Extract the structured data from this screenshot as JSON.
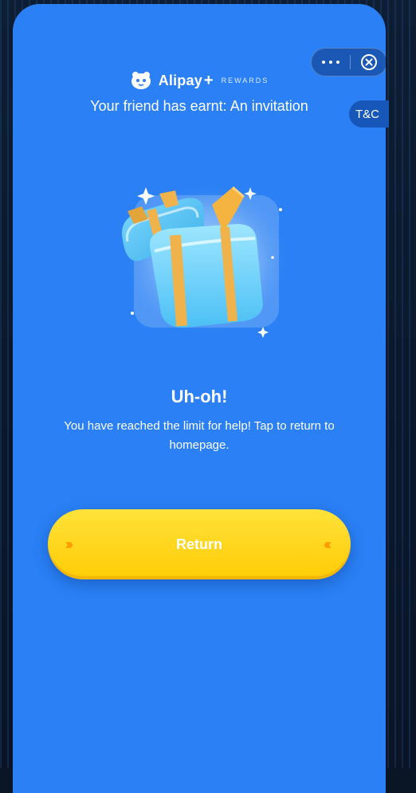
{
  "header": {
    "brand_name": "Alipay",
    "brand_plus": "+",
    "brand_tag": "REWARDS",
    "subtitle": "Your friend has earnt: An invitation"
  },
  "capsule": {
    "more_icon": "more-dots-icon",
    "close_icon": "close-circle-icon"
  },
  "tc_tab": {
    "label": "T&C"
  },
  "main": {
    "heading": "Uh-oh!",
    "message": "You have reached the limit for help! Tap to return to homepage.",
    "return_label": "Return"
  },
  "colors": {
    "background": "#2a80f4",
    "button": "#ffd21a",
    "tc_tab": "#1757b9"
  }
}
